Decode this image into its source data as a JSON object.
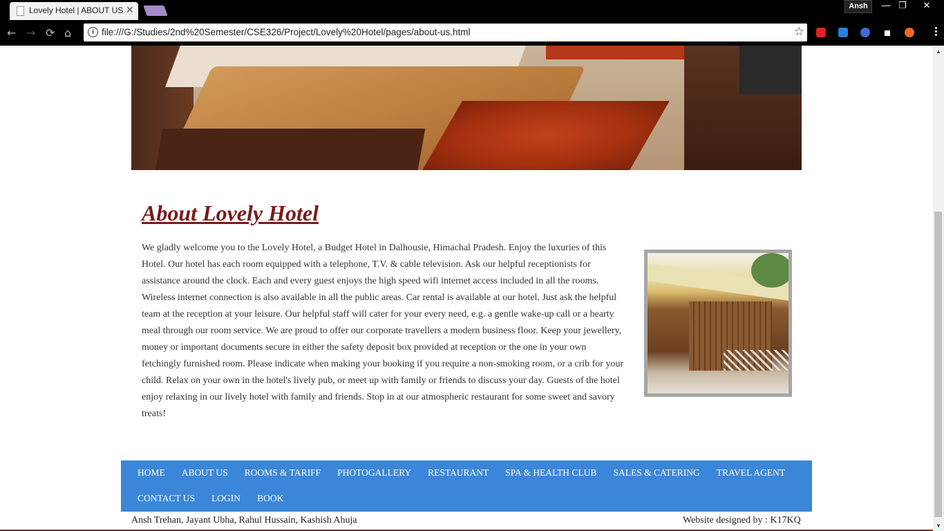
{
  "browser": {
    "tab_title": "Lovely Hotel | ABOUT US",
    "tab_close": "✕",
    "profile_name": "Ansh",
    "url": "file:///G:/Studies/2nd%20Semester/CSE326/Project/Lovely%20Hotel/pages/about-us.html",
    "info_icon": "i",
    "star_icon": "☆",
    "back_icon": "←",
    "forward_icon": "→",
    "reload_icon": "⟳",
    "home_icon": "⌂",
    "minimize_icon": "—",
    "restore_icon": "❐",
    "close_icon": "✕"
  },
  "page": {
    "heading": "About Lovely Hotel",
    "body": "We gladly welcome you to the Lovely Hotel, a Budget Hotel in Dalhousie, Himachal Pradesh. Enjoy the luxuries of this Hotel. Our hotel has each room equipped with a telephone, T.V. & cable television. Ask our helpful receptionists for assistance around the clock. Each and every guest enjoys the high speed wifi internet access included in all the rooms. Wireless internet connection is also available in all the public areas. Car rental is available at our hotel. Just ask the helpful team at the reception at your leisure. Our helpful staff will cater for your every need, e.g. a gentle wake-up call or a hearty meal through our room service. We are proud to offer our corporate travellers a modern business floor. Keep your jewellery, money or important documents secure in either the safety deposit box provided at reception or the one in your own fetchingly furnished room. Please indicate when making your booking if you require a non-smoking room, or a crib for your child. Relax on your own in the hotel's lively pub, or meet up with family or friends to discuss your day. Guests of the hotel enjoy relaxing in our lively hotel with family and friends. Stop in at our atmospheric restaurant for some sweet and savory treats!"
  },
  "footer": {
    "nav": [
      "HOME",
      "ABOUT US",
      "ROOMS & TARIFF",
      "PHOTOGALLERY",
      "RESTAURANT",
      "SPA & HEALTH CLUB",
      "SALES & CATERING",
      "TRAVEL AGENT",
      "CONTACT US",
      "LOGIN",
      "BOOK"
    ],
    "credits_left": "Ansh Trehan, Jayant Ubha, Rahul Hussain, Kashish Ahuja",
    "credits_right": "Website designed by : K17KQ"
  },
  "colors": {
    "heading": "#7a1a1a",
    "nav_bar": "#3b86d8"
  }
}
